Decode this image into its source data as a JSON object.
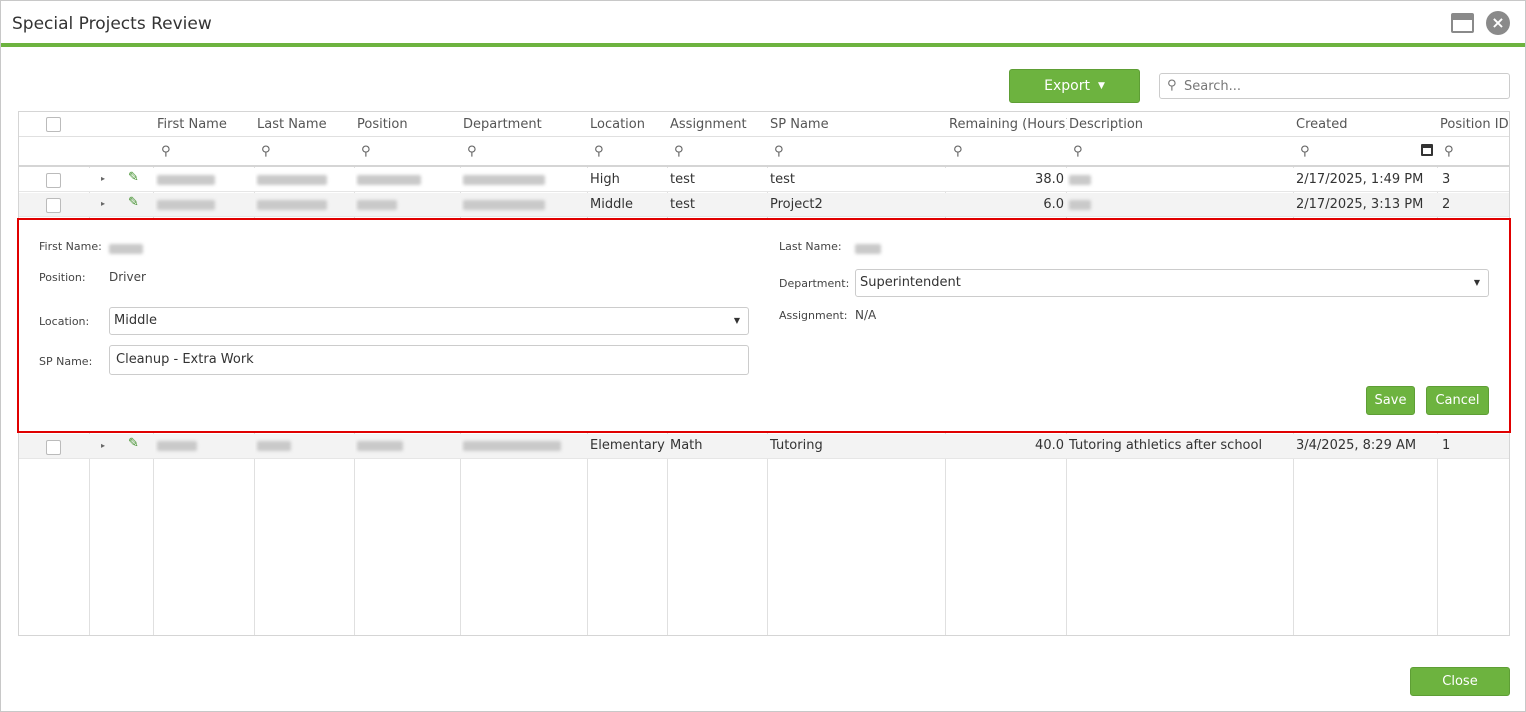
{
  "window": {
    "title": "Special Projects Review",
    "close_glyph": "×"
  },
  "toolbar": {
    "export_label": "Export",
    "search_placeholder": "Search..."
  },
  "grid": {
    "columns": [
      "First Name",
      "Last Name",
      "Position",
      "Department",
      "Location",
      "Assignment",
      "SP Name",
      "Remaining (Hours)",
      "Description",
      "Created",
      "Position ID"
    ],
    "rows": [
      {
        "location": "High",
        "assignment": "test",
        "sp_name": "test",
        "remaining": "38.0",
        "created": "2/17/2025, 1:49 PM",
        "position_id": "3"
      },
      {
        "location": "Middle",
        "assignment": "test",
        "sp_name": "Project2",
        "remaining": "6.0",
        "created": "2/17/2025, 3:13 PM",
        "position_id": "2"
      },
      {
        "location": "Elementary",
        "assignment": "Math",
        "sp_name": "Tutoring",
        "remaining": "40.0",
        "description": "Tutoring athletics after school",
        "created": "3/4/2025, 8:29 AM",
        "position_id": "1"
      }
    ]
  },
  "edit_form": {
    "first_name_label": "First Name:",
    "last_name_label": "Last Name:",
    "position_label": "Position:",
    "position_value": "Driver",
    "department_label": "Department:",
    "department_value": "Superintendent",
    "location_label": "Location:",
    "location_value": "Middle",
    "assignment_label": "Assignment:",
    "assignment_value": "N/A",
    "sp_name_label": "SP Name:",
    "sp_name_value": "Cleanup - Extra Work",
    "save_label": "Save",
    "cancel_label": "Cancel"
  },
  "footer": {
    "close_label": "Close"
  },
  "colors": {
    "accent_green": "#6db33f",
    "edit_outline_red": "#e00000"
  }
}
